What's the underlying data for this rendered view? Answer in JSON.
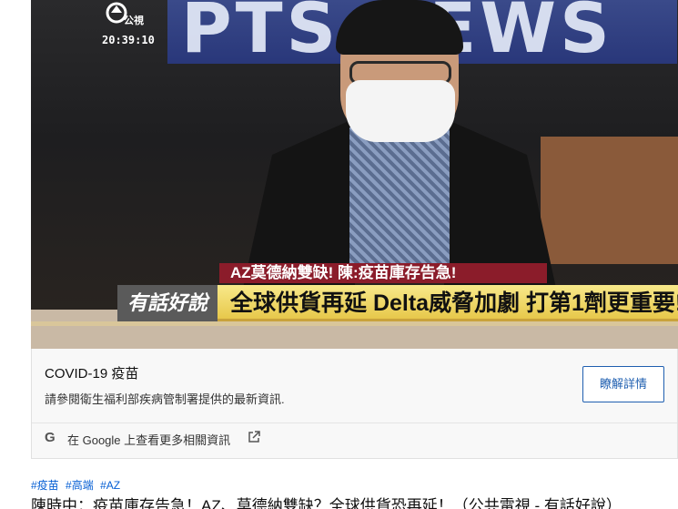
{
  "video": {
    "logo_text": "公視",
    "timestamp": "20:39:10",
    "background_sign": "PTS NEWS",
    "lower_third": {
      "headline": "AZ莫德納雙缺! 陳:疫苗庫存告急!",
      "program_name": "有話好說",
      "main_caption": "全球供貨再延 Delta威脅加劇 打第1劑更重要!"
    }
  },
  "info_card": {
    "title": "COVID-19 疫苗",
    "description": "請參閱衛生福利部疾病管制署提供的最新資訊.",
    "button_label": "瞭解詳情",
    "google_link_text": "在 Google 上查看更多相關資訊",
    "google_icon": "google-g-icon",
    "external_icon": "external-link-icon"
  },
  "tags": [
    "#疫苗",
    "#高端",
    "#AZ"
  ],
  "video_title": "陳時中：疫苗庫存告急！AZ、莫德納雙缺？全球供貨恐再延！（公共電視 - 有話好說）",
  "colors": {
    "link_blue": "#065fd4",
    "button_blue": "#1f5fb0",
    "lower_third_red": "#8b1c2a",
    "lower_third_yellow": "#e7c84b"
  }
}
